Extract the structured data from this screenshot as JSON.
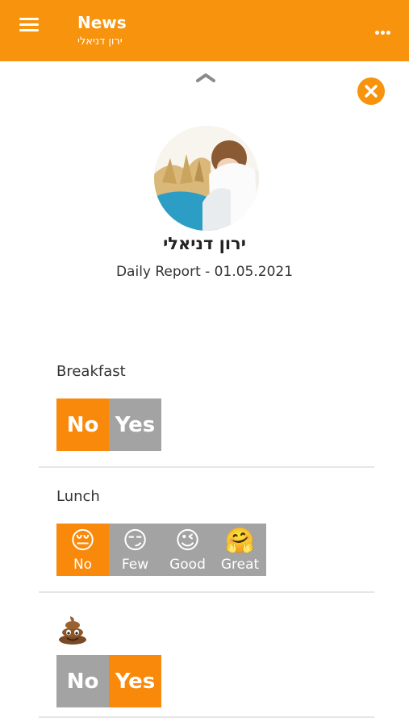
{
  "header": {
    "title": "News",
    "subtitle": "ירון דניאלי"
  },
  "profile": {
    "name": "ירון דניאלי",
    "report_title": "Daily Report - 01.05.2021"
  },
  "breakfast": {
    "label": "Breakfast",
    "options": [
      {
        "label": "No",
        "selected": true
      },
      {
        "label": "Yes",
        "selected": false
      }
    ]
  },
  "lunch": {
    "label": "Lunch",
    "options": [
      {
        "emoji": "😔",
        "label": "No",
        "selected": true
      },
      {
        "emoji": "😏",
        "label": "Few",
        "selected": false
      },
      {
        "emoji": "😉",
        "label": "Good",
        "selected": false
      },
      {
        "emoji": "🤗",
        "label": "Great",
        "selected": false
      }
    ]
  },
  "poop": {
    "icon": "poop-icon",
    "options": [
      {
        "label": "No",
        "selected": false
      },
      {
        "label": "Yes",
        "selected": true
      }
    ]
  },
  "colors": {
    "accent": "#f8930e",
    "selected": "#f8890a",
    "unselected": "#a3a3a3"
  }
}
